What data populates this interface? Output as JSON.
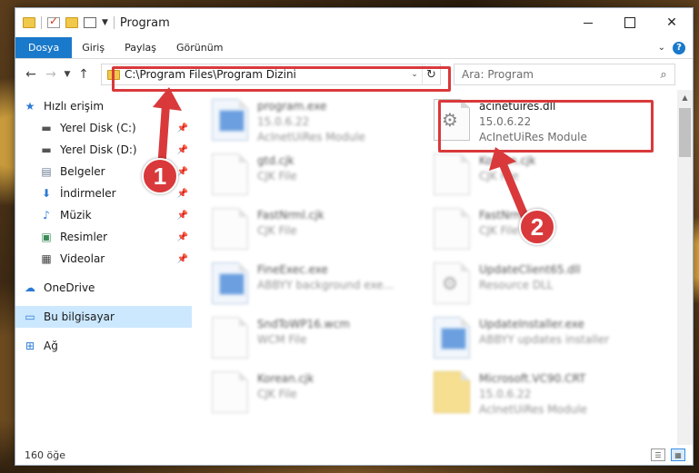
{
  "window": {
    "title": "Program",
    "controls": {
      "close": "✕"
    }
  },
  "ribbon": {
    "tabs": [
      "Dosya",
      "Giriş",
      "Paylaş",
      "Görünüm"
    ],
    "help": "?"
  },
  "address": {
    "path": "C:\\Program Files\\Program Dizini"
  },
  "search": {
    "placeholder": "Ara: Program"
  },
  "nav": {
    "items": [
      {
        "label": "Hızlı erişim",
        "icon": "star-icon",
        "pinned": false
      },
      {
        "label": "Yerel Disk (C:)",
        "icon": "drive-icon",
        "pinned": true
      },
      {
        "label": "Yerel Disk (D:)",
        "icon": "drive-icon",
        "pinned": true
      },
      {
        "label": "Belgeler",
        "icon": "documents-icon",
        "pinned": true
      },
      {
        "label": "İndirmeler",
        "icon": "download-icon",
        "pinned": true
      },
      {
        "label": "Müzik",
        "icon": "music-icon",
        "pinned": true
      },
      {
        "label": "Resimler",
        "icon": "pictures-icon",
        "pinned": true
      },
      {
        "label": "Videolar",
        "icon": "video-icon",
        "pinned": true
      },
      {
        "label": "OneDrive",
        "icon": "cloud-icon",
        "pinned": false
      },
      {
        "label": "Bu bilgisayar",
        "icon": "computer-icon",
        "pinned": false,
        "selected": true
      },
      {
        "label": "Ağ",
        "icon": "network-icon",
        "pinned": false
      }
    ]
  },
  "files": [
    {
      "name": "program.exe",
      "line2": "15.0.6.22",
      "line3": "AcInetUiRes Module",
      "kind": "exe",
      "blurred": true
    },
    {
      "name": "acinetuires.dll",
      "line2": "15.0.6.22",
      "line3": "AcInetUiRes Module",
      "kind": "dll",
      "blurred": false,
      "highlighted": true
    },
    {
      "name": "gtd.cjk",
      "line2": "CJK File",
      "line3": "",
      "kind": "file",
      "blurred": true
    },
    {
      "name": "Korean.cjk",
      "line2": "CJK File",
      "line3": "",
      "kind": "file",
      "blurred": true
    },
    {
      "name": "FastNrml.cjk",
      "line2": "CJK File",
      "line3": "",
      "kind": "file",
      "blurred": true
    },
    {
      "name": "FastNrml.cjk",
      "line2": "CJK File",
      "line3": "",
      "kind": "file",
      "blurred": true
    },
    {
      "name": "FineExec.exe",
      "line2": "ABBYY background exe...",
      "line3": "",
      "kind": "exe",
      "blurred": true
    },
    {
      "name": "UpdateClient65.dll",
      "line2": "Resource DLL",
      "line3": "",
      "kind": "dll",
      "blurred": true
    },
    {
      "name": "SndToWP16.wcm",
      "line2": "WCM File",
      "line3": "",
      "kind": "file",
      "blurred": true
    },
    {
      "name": "UpdateInstaller.exe",
      "line2": "ABBYY updates installer",
      "line3": "",
      "kind": "exe",
      "blurred": true
    },
    {
      "name": "Korean.cjk",
      "line2": "CJK File",
      "line3": "",
      "kind": "file",
      "blurred": true
    },
    {
      "name": "Microsoft.VC90.CRT",
      "line2": "15.0.6.22",
      "line3": "AcInetUiRes Module",
      "kind": "folder",
      "blurred": true
    }
  ],
  "status": {
    "count": "160 öğe"
  },
  "annotations": {
    "badge1": "1",
    "badge2": "2"
  },
  "colors": {
    "accent": "#1979ca",
    "highlight": "#d9393b",
    "selected": "#cce8ff"
  }
}
